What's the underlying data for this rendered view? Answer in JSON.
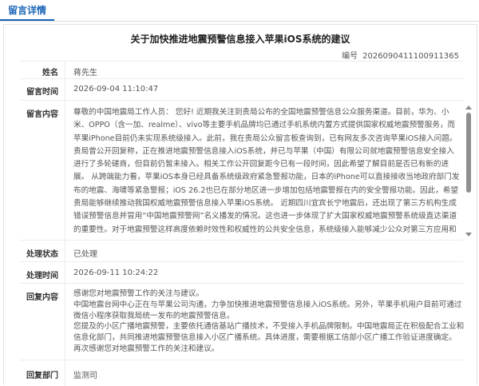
{
  "tab": {
    "label": "留言详情"
  },
  "title": "关于加快推进地震预警信息接入苹果iOS系统的建议",
  "serial": {
    "label": "编号",
    "value": "2026090411100911365"
  },
  "fields": {
    "name": {
      "label": "姓名",
      "value": "蒋先生"
    },
    "time": {
      "label": "留言时间",
      "value": "2026-09-04 11:10:47"
    },
    "content": {
      "label": "留言内容",
      "value": "尊敬的中国地震局工作人员： 您好! 近期我关注到贵局公布的全国地震预警信息公众服务渠道。目前，华为、小米、OPPO（含一加、realme）、vivo等主要手机品牌均已通过手机系统内置方式提供国家权威地震预警服务，而苹果iPhone目前仍未实现系统级接入。此前，我在贵局公众留言板查询到，已有网友多次咨询苹果iOS接入问题。贵局曾公开回复称，正在推进地震预警信息接入iOS系统，并已与苹果（中国）有限公司就地震预警信息安全接入进行了多轮磋商，但目前仍暂未接入。相关工作公开回复距今已有一段时间，因此希望了解目前是否已有新的进展。 从跨端能力看，苹果iOS本身已经具备系统级政府紧急警报功能，日本的iPhone可以直接接收当地政府部门发布的地震、海啸等紧急警报；iOS 26.2也已在部分地区进一步增加包括地震警报在内的安全警报功能。因此，希望贵局能够继续推动我国权威地震预警信息接入苹果iOS系统。 近期四川宜宾长宁地震后，还出现了第三方机构生成错误预警信息并冒用“中国地震预警网”名义播发的情况。这也进一步体现了扩大国家权威地震预警系统级直达渠道的重要性。对于地震预警这样高度依赖时效性和权威性的公共安全信息，系统级接入能够减少公众对第三方应用和来源不明信息的依赖。 因此想重点咨询：贵局与苹果（中国）有限公司多轮磋商后，目前iOS系统级地震预警接入工作处于什么阶段？尚"
    },
    "status": {
      "label": "处理状态",
      "value": "已处理"
    },
    "handle_time": {
      "label": "处理时间",
      "value": "2026-09-11 10:24:22"
    },
    "reply": {
      "label": "回复内容",
      "lines": [
        "感谢您对地震预警工作的关注与建议。",
        "中国地震台网中心正在与苹果公司沟通，力争加快推进地震预警信息接入iOS系统。另外，苹果手机用户目前可通过微信小程序获取我局统一发布的地震预警信息。",
        "您提及的小区广播地震预警，主要依托通信基站广播技术，不受接入手机品牌限制。中国地震局正在积极配合工业和信息化部门，共同推进地震预警信息接入小区广播系统。具体进度，需要根据工信部小区广播工作验证进度确定。",
        "再次感谢您对地震预警工作的关注和建议。"
      ]
    },
    "dept": {
      "label": "回复部门",
      "value": "监测司"
    }
  },
  "icons": {
    "scroll_up": "scroll-up-arrow-icon",
    "scroll_down": "scroll-down-arrow-icon"
  },
  "colors": {
    "accent": "#1b64b8",
    "scroll_thumb": "#8f8f8f"
  }
}
